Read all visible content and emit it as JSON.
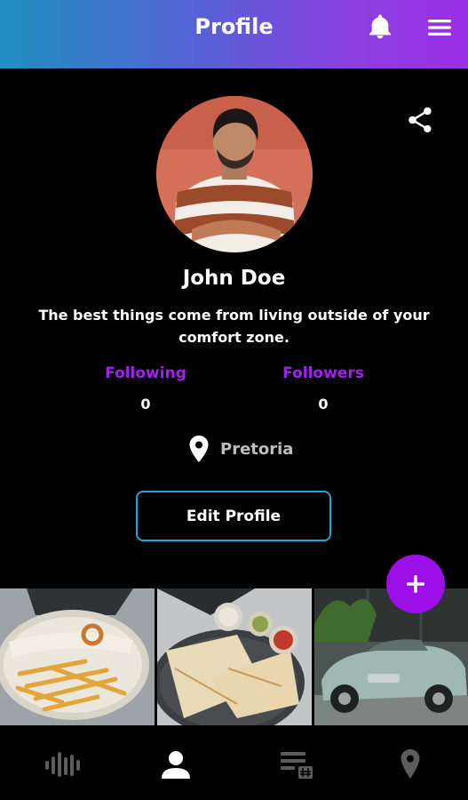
{
  "header": {
    "title": "Profile",
    "icons": [
      "bell-icon",
      "menu-icon"
    ]
  },
  "profile": {
    "name": "John Doe",
    "bio": "The best things come from living outside of your comfort zone.",
    "following_label": "Following",
    "following_count": "0",
    "followers_label": "Followers",
    "followers_count": "0",
    "location": "Pretoria",
    "edit_label": "Edit Profile"
  },
  "actions": {
    "share_icon": "share-icon",
    "add_icon": "plus-icon"
  },
  "photos": [
    "burrito-and-fries",
    "quesadilla",
    "vintage-car"
  ],
  "bottom_nav": {
    "items": [
      "stats-icon",
      "profile-icon",
      "list-icon",
      "map-pin-icon"
    ],
    "active": "profile-icon"
  },
  "colors": {
    "accent": "#9b10e8",
    "label": "#a020f0",
    "button_border": "#1fa6d6"
  }
}
